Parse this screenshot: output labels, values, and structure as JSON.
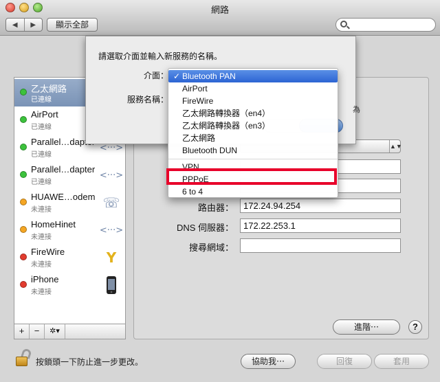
{
  "window": {
    "title": "網路"
  },
  "toolbar": {
    "back": "◀",
    "forward": "▶",
    "show_all": "顯示全部",
    "search_placeholder": ""
  },
  "sidebar": {
    "items": [
      {
        "name": "乙太網路",
        "status": "已連線",
        "dot": "#3cc23c",
        "icon": "ethernet-icon",
        "glyph": ""
      },
      {
        "name": "AirPort",
        "status": "已連線",
        "dot": "#3cc23c",
        "icon": "wifi-icon",
        "glyph": ""
      },
      {
        "name": "Parallel…dapter",
        "status": "已連線",
        "dot": "#3cc23c",
        "icon": "network-adapter-icon",
        "glyph": "<···>"
      },
      {
        "name": "Parallel…dapter",
        "status": "已連線",
        "dot": "#3cc23c",
        "icon": "network-adapter-icon",
        "glyph": "<···>"
      },
      {
        "name": "HUAWE…odem",
        "status": "未連接",
        "dot": "#f5a623",
        "icon": "modem-phone-icon",
        "glyph": "☏"
      },
      {
        "name": "HomeHinet",
        "status": "未連接",
        "dot": "#f5a623",
        "icon": "network-adapter-icon",
        "glyph": "<···>"
      },
      {
        "name": "FireWire",
        "status": "未連接",
        "dot": "#e23b2e",
        "icon": "firewire-icon",
        "glyph": "Y"
      },
      {
        "name": "iPhone",
        "status": "未連接",
        "dot": "#e23b2e",
        "icon": "iphone-icon",
        "glyph": ""
      }
    ],
    "add": "+",
    "remove": "−",
    "gear": "✲▾"
  },
  "detail": {
    "router_label": "路由器：",
    "router_value": "172.24.94.254",
    "dns_label": "DNS 伺服器：",
    "dns_value": "172.22.253.1",
    "search_domain_label": "搜尋網域：",
    "search_domain_value": "",
    "advanced_button": "進階⋯",
    "help_button": "?"
  },
  "footer": {
    "lock_text": "按鎖頭一下防止進一步更改。",
    "assist_button": "協助我⋯",
    "revert_button": "回復",
    "apply_button": "套用"
  },
  "sheet": {
    "prompt": "請選取介面並輸入新服務的名稱。",
    "interface_label": "介面：",
    "service_name_label": "服務名稱：",
    "edge_text": "為"
  },
  "menu": {
    "items": [
      {
        "label": "Bluetooth PAN",
        "checked": true,
        "highlighted": true
      },
      {
        "label": "AirPort"
      },
      {
        "label": "FireWire"
      },
      {
        "label": "乙太網路轉換器（en4）"
      },
      {
        "label": "乙太網路轉換器（en3）"
      },
      {
        "label": "乙太網路"
      },
      {
        "label": "Bluetooth DUN"
      },
      {
        "label": "VPN"
      },
      {
        "label": "PPPoE"
      },
      {
        "label": "6 to 4"
      }
    ],
    "check_mark": "✓"
  },
  "annotation": {
    "highlighted_item": "PPPoE",
    "color": "#e8002a"
  }
}
